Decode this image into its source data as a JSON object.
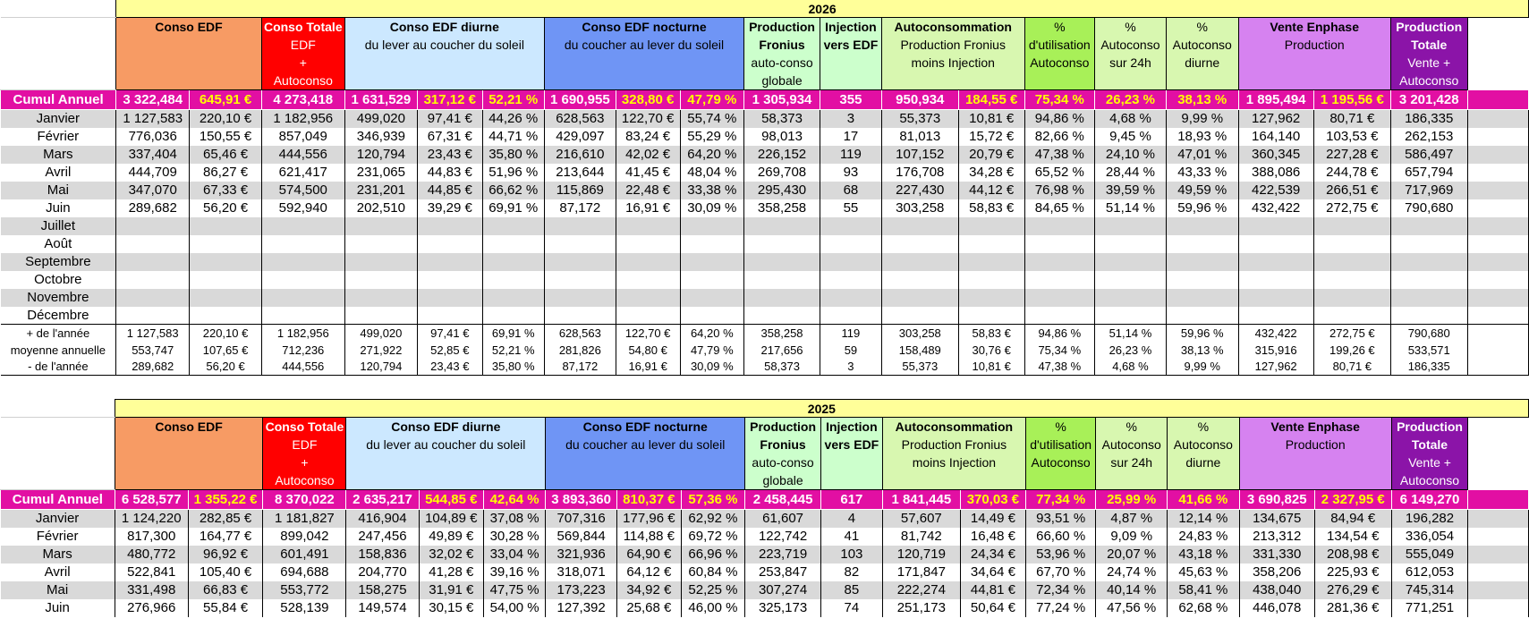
{
  "sections": [
    {
      "year": "2026",
      "headers": {
        "conso_edf": [
          "Conso EDF"
        ],
        "conso_totale": [
          "Conso Totale",
          "EDF",
          "+",
          "Autoconso"
        ],
        "diurne": [
          "Conso EDF diurne",
          "du lever au coucher du soleil"
        ],
        "nocturne": [
          "Conso EDF nocturne",
          "du coucher au lever du soleil"
        ],
        "production": [
          "Production",
          "Fronius",
          "auto-conso",
          "globale"
        ],
        "injection": [
          "Injection",
          "vers EDF"
        ],
        "autoconso": [
          "Autoconsommation",
          "Production Fronius",
          "moins Injection"
        ],
        "pct_util": [
          "%",
          "d'utilisation",
          "Autoconso"
        ],
        "pct_24h": [
          "%",
          "Autoconso",
          "sur 24h"
        ],
        "pct_diurne": [
          "%",
          "Autoconso",
          "diurne"
        ],
        "vente": [
          "Vente Enphase",
          "Production"
        ],
        "prod_totale": [
          "Production",
          "Totale",
          "Vente +",
          "Autoconso"
        ]
      },
      "cumul": {
        "label": "Cumul Annuel",
        "values": [
          "3 322,484",
          "645,91 €",
          "4 273,418",
          "1 631,529",
          "317,12 €",
          "52,21 %",
          "1 690,955",
          "328,80 €",
          "47,79 %",
          "1 305,934",
          "355",
          "950,934",
          "184,55 €",
          "75,34 %",
          "26,23 %",
          "38,13 %",
          "1 895,494",
          "1 195,56 €",
          "3 201,428"
        ]
      },
      "months": [
        {
          "label": "Janvier",
          "values": [
            "1 127,583",
            "220,10 €",
            "1 182,956",
            "499,020",
            "97,41 €",
            "44,26 %",
            "628,563",
            "122,70 €",
            "55,74 %",
            "58,373",
            "3",
            "55,373",
            "10,81 €",
            "94,86 %",
            "4,68 %",
            "9,99 %",
            "127,962",
            "80,71 €",
            "186,335"
          ]
        },
        {
          "label": "Février",
          "values": [
            "776,036",
            "150,55 €",
            "857,049",
            "346,939",
            "67,31 €",
            "44,71 %",
            "429,097",
            "83,24 €",
            "55,29 %",
            "98,013",
            "17",
            "81,013",
            "15,72 €",
            "82,66 %",
            "9,45 %",
            "18,93 %",
            "164,140",
            "103,53 €",
            "262,153"
          ]
        },
        {
          "label": "Mars",
          "values": [
            "337,404",
            "65,46 €",
            "444,556",
            "120,794",
            "23,43 €",
            "35,80 %",
            "216,610",
            "42,02 €",
            "64,20 %",
            "226,152",
            "119",
            "107,152",
            "20,79 €",
            "47,38 %",
            "24,10 %",
            "47,01 %",
            "360,345",
            "227,28 €",
            "586,497"
          ]
        },
        {
          "label": "Avril",
          "values": [
            "444,709",
            "86,27 €",
            "621,417",
            "231,065",
            "44,83 €",
            "51,96 %",
            "213,644",
            "41,45 €",
            "48,04 %",
            "269,708",
            "93",
            "176,708",
            "34,28 €",
            "65,52 %",
            "28,44 %",
            "43,33 %",
            "388,086",
            "244,78 €",
            "657,794"
          ]
        },
        {
          "label": "Mai",
          "values": [
            "347,070",
            "67,33 €",
            "574,500",
            "231,201",
            "44,85 €",
            "66,62 %",
            "115,869",
            "22,48 €",
            "33,38 %",
            "295,430",
            "68",
            "227,430",
            "44,12 €",
            "76,98 %",
            "39,59 %",
            "49,59 %",
            "422,539",
            "266,51 €",
            "717,969"
          ]
        },
        {
          "label": "Juin",
          "values": [
            "289,682",
            "56,20 €",
            "592,940",
            "202,510",
            "39,29 €",
            "69,91 %",
            "87,172",
            "16,91 €",
            "30,09 %",
            "358,258",
            "55",
            "303,258",
            "58,83 €",
            "84,65 %",
            "51,14 %",
            "59,96 %",
            "432,422",
            "272,75 €",
            "790,680"
          ]
        },
        {
          "label": "Juillet",
          "values": []
        },
        {
          "label": "Août",
          "values": []
        },
        {
          "label": "Septembre",
          "values": []
        },
        {
          "label": "Octobre",
          "values": []
        },
        {
          "label": "Novembre",
          "values": []
        },
        {
          "label": "Décembre",
          "values": []
        }
      ],
      "stats": [
        {
          "label": "+ de l'année",
          "values": [
            "1 127,583",
            "220,10 €",
            "1 182,956",
            "499,020",
            "97,41 €",
            "69,91 %",
            "628,563",
            "122,70 €",
            "64,20 %",
            "358,258",
            "119",
            "303,258",
            "58,83 €",
            "94,86 %",
            "51,14 %",
            "59,96 %",
            "432,422",
            "272,75 €",
            "790,680"
          ]
        },
        {
          "label": "moyenne annuelle",
          "values": [
            "553,747",
            "107,65 €",
            "712,236",
            "271,922",
            "52,85 €",
            "52,21 %",
            "281,826",
            "54,80 €",
            "47,79 %",
            "217,656",
            "59",
            "158,489",
            "30,76 €",
            "75,34 %",
            "26,23 %",
            "38,13 %",
            "315,916",
            "199,26 €",
            "533,571"
          ]
        },
        {
          "label": "- de l'année",
          "values": [
            "289,682",
            "56,20 €",
            "444,556",
            "120,794",
            "23,43 €",
            "35,80 %",
            "87,172",
            "16,91 €",
            "30,09 %",
            "58,373",
            "3",
            "55,373",
            "10,81 €",
            "47,38 %",
            "4,68 %",
            "9,99 %",
            "127,962",
            "80,71 €",
            "186,335"
          ]
        }
      ]
    },
    {
      "year": "2025",
      "headers": {
        "conso_edf": [
          "Conso EDF"
        ],
        "conso_totale": [
          "Conso Totale",
          "EDF",
          "+",
          "Autoconso"
        ],
        "diurne": [
          "Conso EDF diurne",
          "du lever au coucher du soleil"
        ],
        "nocturne": [
          "Conso EDF nocturne",
          "du coucher au lever du soleil"
        ],
        "production": [
          "Production",
          "Fronius",
          "auto-conso",
          "globale"
        ],
        "injection": [
          "Injection",
          "vers EDF"
        ],
        "autoconso": [
          "Autoconsommation",
          "Production Fronius",
          "moins Injection"
        ],
        "pct_util": [
          "%",
          "d'utilisation",
          "Autoconso"
        ],
        "pct_24h": [
          "%",
          "Autoconso",
          "sur 24h"
        ],
        "pct_diurne": [
          "%",
          "Autoconso",
          "diurne"
        ],
        "vente": [
          "Vente Enphase",
          "Production"
        ],
        "prod_totale": [
          "Production",
          "Totale",
          "Vente +",
          "Autoconso"
        ]
      },
      "cumul": {
        "label": "Cumul Annuel",
        "values": [
          "6 528,577",
          "1 355,22 €",
          "8 370,022",
          "2 635,217",
          "544,85 €",
          "42,64 %",
          "3 893,360",
          "810,37 €",
          "57,36 %",
          "2 458,445",
          "617",
          "1 841,445",
          "370,03 €",
          "77,34 %",
          "25,99 %",
          "41,66 %",
          "3 690,825",
          "2 327,95 €",
          "6 149,270"
        ]
      },
      "months": [
        {
          "label": "Janvier",
          "values": [
            "1 124,220",
            "282,85 €",
            "1 181,827",
            "416,904",
            "104,89 €",
            "37,08 %",
            "707,316",
            "177,96 €",
            "62,92 %",
            "61,607",
            "4",
            "57,607",
            "14,49 €",
            "93,51 %",
            "4,87 %",
            "12,14 %",
            "134,675",
            "84,94 €",
            "196,282"
          ]
        },
        {
          "label": "Février",
          "values": [
            "817,300",
            "164,77 €",
            "899,042",
            "247,456",
            "49,89 €",
            "30,28 %",
            "569,844",
            "114,88 €",
            "69,72 %",
            "122,742",
            "41",
            "81,742",
            "16,48 €",
            "66,60 %",
            "9,09 %",
            "24,83 %",
            "213,312",
            "134,54 €",
            "336,054"
          ]
        },
        {
          "label": "Mars",
          "values": [
            "480,772",
            "96,92 €",
            "601,491",
            "158,836",
            "32,02 €",
            "33,04 %",
            "321,936",
            "64,90 €",
            "66,96 %",
            "223,719",
            "103",
            "120,719",
            "24,34 €",
            "53,96 %",
            "20,07 %",
            "43,18 %",
            "331,330",
            "208,98 €",
            "555,049"
          ]
        },
        {
          "label": "Avril",
          "values": [
            "522,841",
            "105,40 €",
            "694,688",
            "204,770",
            "41,28 €",
            "39,16 %",
            "318,071",
            "64,12 €",
            "60,84 %",
            "253,847",
            "82",
            "171,847",
            "34,64 €",
            "67,70 %",
            "24,74 %",
            "45,63 %",
            "358,206",
            "225,93 €",
            "612,053"
          ]
        },
        {
          "label": "Mai",
          "values": [
            "331,498",
            "66,83 €",
            "553,772",
            "158,275",
            "31,91 €",
            "47,75 %",
            "173,223",
            "34,92 €",
            "52,25 %",
            "307,274",
            "85",
            "222,274",
            "44,81 €",
            "72,34 %",
            "40,14 %",
            "58,41 %",
            "438,040",
            "276,29 €",
            "745,314"
          ]
        },
        {
          "label": "Juin",
          "values": [
            "276,966",
            "55,84 €",
            "528,139",
            "149,574",
            "30,15 €",
            "54,00 %",
            "127,392",
            "25,68 €",
            "46,00 %",
            "325,173",
            "74",
            "251,173",
            "50,64 €",
            "77,24 %",
            "47,56 %",
            "62,68 %",
            "446,078",
            "281,36 €",
            "771,251"
          ]
        }
      ],
      "stats": []
    }
  ]
}
